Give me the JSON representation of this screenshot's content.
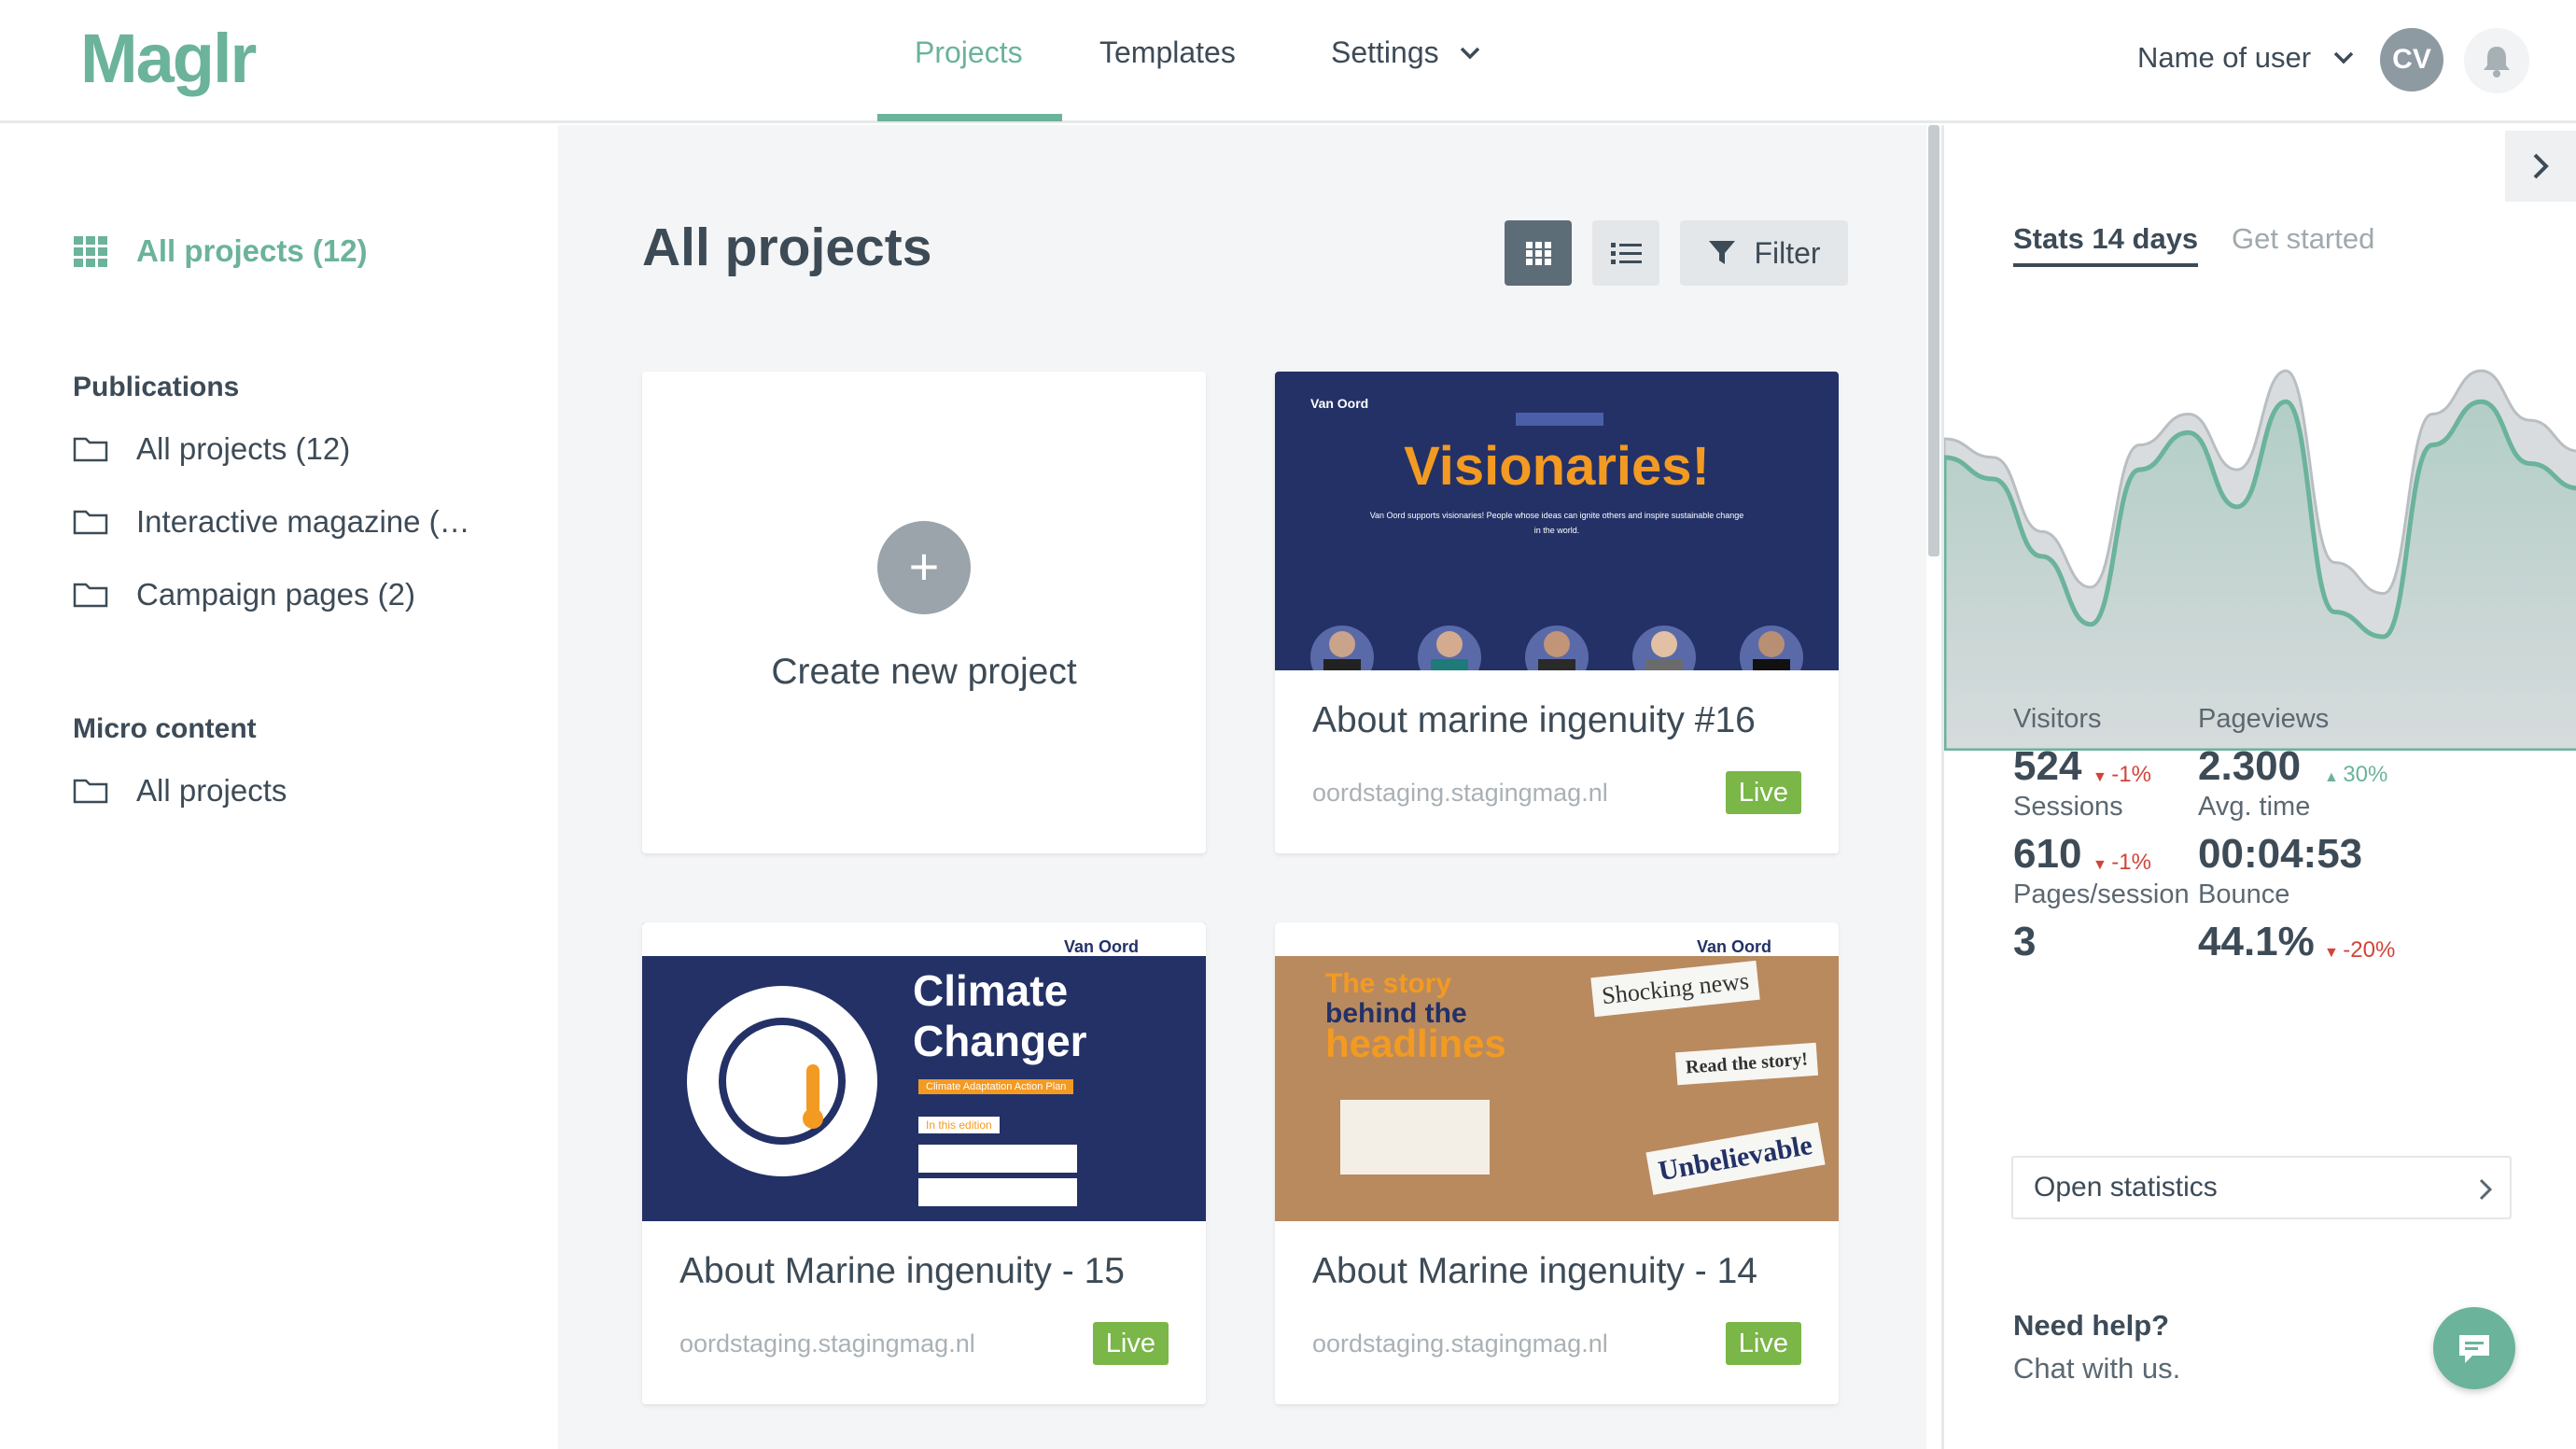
{
  "app": {
    "logo": "Maglr"
  },
  "header": {
    "nav": [
      {
        "label": "Projects"
      },
      {
        "label": "Templates"
      },
      {
        "label": "Settings"
      }
    ],
    "user_name": "Name of user",
    "avatar_initials": "CV"
  },
  "sidebar": {
    "all_projects": "All projects (12)",
    "sections": [
      {
        "heading": "Publications",
        "items": [
          "All projects (12)",
          "Interactive magazine (…",
          "Campaign pages (2)"
        ]
      },
      {
        "heading": "Micro content",
        "items": [
          "All projects"
        ]
      }
    ]
  },
  "main": {
    "title": "All projects",
    "filter_label": "Filter",
    "create_label": "Create new project",
    "cards": [
      {
        "title": "About marine ingenuity #16",
        "url": "oordstaging.stagingmag.nl",
        "status": "Live",
        "thumb": {
          "brand": "Van Oord",
          "headline": "Visionaries!",
          "caption": "Van Oord supports visionaries! People whose ideas can ignite others and inspire sustainable change in the world."
        }
      },
      {
        "title": "About Marine ingenuity - 15",
        "url": "oordstaging.stagingmag.nl",
        "status": "Live",
        "thumb": {
          "brand": "Van Oord",
          "headline_1": "Climate",
          "headline_2": "Changer",
          "tag": "Climate Adaptation Action Plan",
          "edition": "In this edition"
        }
      },
      {
        "title": "About Marine ingenuity - 14",
        "url": "oordstaging.stagingmag.nl",
        "status": "Live",
        "thumb": {
          "brand": "Van Oord",
          "headline_1": "The story",
          "headline_2": "behind the",
          "headline_3": "headlines",
          "note_1": "Shocking news",
          "note_2": "Read the story!",
          "note_3": "Unbelievable"
        }
      }
    ]
  },
  "stats": {
    "tabs": [
      "Stats 14 days",
      "Get started"
    ],
    "chart_data": {
      "type": "area",
      "series": [
        {
          "values": [
            62,
            55,
            30,
            8,
            58,
            70,
            46,
            80,
            12,
            4,
            66,
            80,
            60,
            52
          ]
        },
        {
          "values": [
            68,
            62,
            38,
            20,
            66,
            76,
            58,
            90,
            28,
            18,
            76,
            90,
            74,
            64
          ]
        }
      ],
      "colors": [
        "#6bb39b",
        "#b8bec2"
      ]
    },
    "metrics": [
      {
        "label": "Visitors",
        "value": "524",
        "change": "-1%",
        "dir": "down"
      },
      {
        "label": "Pageviews",
        "value": "2.300",
        "change": "30%",
        "dir": "up"
      },
      {
        "label": "Sessions",
        "value": "610",
        "change": "-1%",
        "dir": "down"
      },
      {
        "label": "Avg. time",
        "value": "00:04:53",
        "change": "",
        "dir": ""
      },
      {
        "label": "Pages/session",
        "value": "3",
        "change": "",
        "dir": ""
      },
      {
        "label": "Bounce",
        "value": "44.1%",
        "change": "-20%",
        "dir": "down"
      }
    ],
    "open_stats": "Open statistics",
    "help_title": "Need help?",
    "help_sub": "Chat with us."
  },
  "colors": {
    "accent": "#6bb39b",
    "live": "#7ab648",
    "card_dark": "#233167",
    "orange": "#f39a22"
  }
}
